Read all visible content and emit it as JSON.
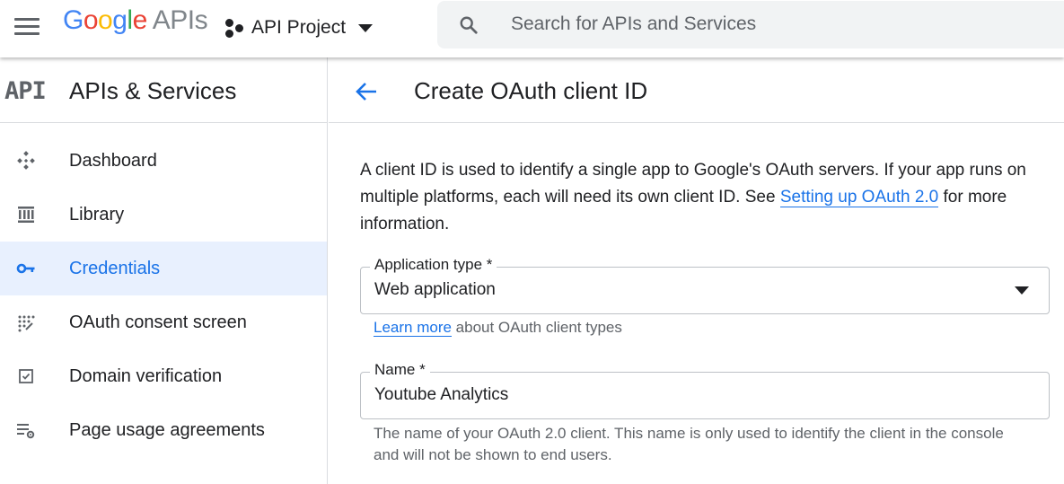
{
  "topbar": {
    "logo_letters": [
      "G",
      "o",
      "o",
      "g",
      "l",
      "e"
    ],
    "logo_suffix": "APIs",
    "project_name": "API Project",
    "search_placeholder": "Search for APIs and Services"
  },
  "sidebar": {
    "badge": "API",
    "title": "APIs & Services",
    "items": [
      {
        "label": "Dashboard",
        "icon": "dashboard-icon"
      },
      {
        "label": "Library",
        "icon": "library-icon"
      },
      {
        "label": "Credentials",
        "icon": "key-icon",
        "active": true
      },
      {
        "label": "OAuth consent screen",
        "icon": "consent-icon"
      },
      {
        "label": "Domain verification",
        "icon": "checkbox-icon"
      },
      {
        "label": "Page usage agreements",
        "icon": "settings-list-icon"
      }
    ]
  },
  "main": {
    "title": "Create OAuth client ID",
    "intro_before": "A client ID is used to identify a single app to Google's OAuth servers. If your app runs on multiple platforms, each will need its own client ID. See ",
    "intro_link": "Setting up OAuth 2.0",
    "intro_after": " for more information.",
    "app_type": {
      "label": "Application type *",
      "value": "Web application",
      "hint_link": "Learn more",
      "hint_text": " about OAuth client types"
    },
    "name": {
      "label": "Name *",
      "value": "Youtube Analytics",
      "hint": "The name of your OAuth 2.0 client. This name is only used to identify the client in the console and will not be shown to end users."
    }
  },
  "colors": {
    "accent": "#1a73e8",
    "active_bg": "#e8f0fe",
    "icon_grey": "#5f6368"
  }
}
